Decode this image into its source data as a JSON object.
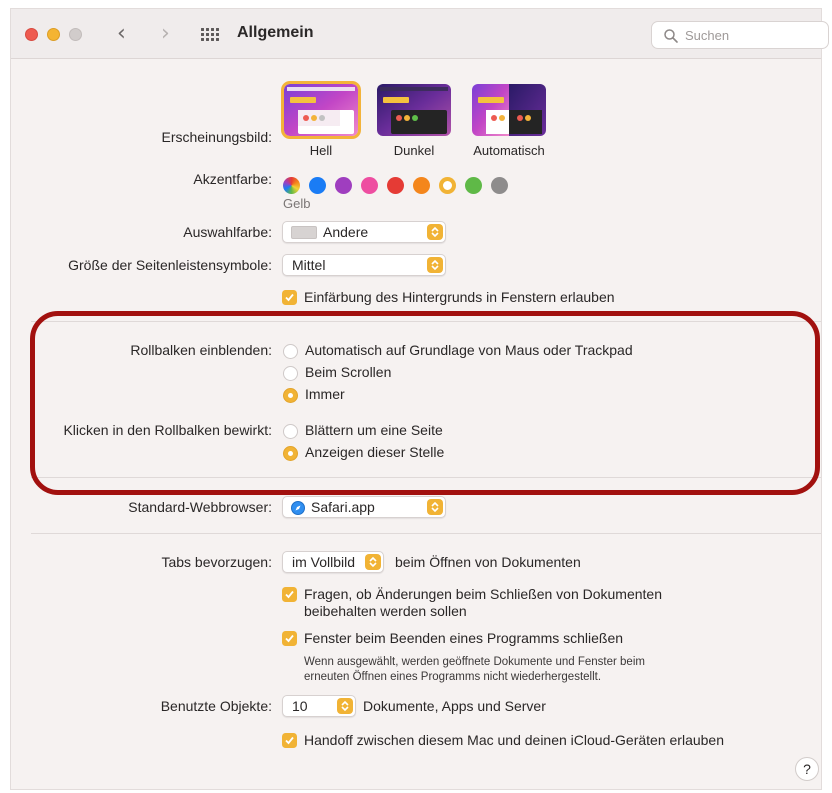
{
  "window": {
    "title": "Allgemein"
  },
  "search": {
    "placeholder": "Suchen"
  },
  "appearance": {
    "label": "Erscheinungsbild:",
    "options": [
      {
        "label": "Hell",
        "selected": true
      },
      {
        "label": "Dunkel",
        "selected": false
      },
      {
        "label": "Automatisch",
        "selected": false
      }
    ]
  },
  "accent": {
    "label": "Akzentfarbe:",
    "selected_name": "Gelb",
    "colors": [
      "multicolor",
      "#1a7cf5",
      "#9f3ebf",
      "#ee4ea1",
      "#e53b35",
      "#f4861c",
      "#f1b335",
      "#5fb947",
      "#8e8c8c"
    ]
  },
  "highlight_color": {
    "label": "Auswahlfarbe:",
    "value": "Andere"
  },
  "sidebar_icon_size": {
    "label": "Größe der Seitenleistensymbole:",
    "value": "Mittel"
  },
  "wallpaper_tinting": {
    "label": "Einfärbung des Hintergrunds in Fenstern erlauben",
    "checked": true
  },
  "show_scroll_bars": {
    "label": "Rollbalken einblenden:",
    "options": [
      {
        "label": "Automatisch auf Grundlage von Maus oder Trackpad",
        "selected": false
      },
      {
        "label": "Beim Scrollen",
        "selected": false
      },
      {
        "label": "Immer",
        "selected": true
      }
    ]
  },
  "click_scroll_bar": {
    "label": "Klicken in den Rollbalken bewirkt:",
    "options": [
      {
        "label": "Blättern um eine Seite",
        "selected": false
      },
      {
        "label": "Anzeigen dieser Stelle",
        "selected": true
      }
    ]
  },
  "default_browser": {
    "label": "Standard-Webbrowser:",
    "value": "Safari.app"
  },
  "prefer_tabs": {
    "label": "Tabs bevorzugen:",
    "value": "im Vollbild",
    "suffix": "beim Öffnen von Dokumenten"
  },
  "ask_keep_changes": {
    "label_line1": "Fragen, ob Änderungen beim Schließen von Dokumenten",
    "label_line2": "beibehalten werden sollen",
    "checked": true
  },
  "close_windows": {
    "label": "Fenster beim Beenden eines Programms schließen",
    "checked": true,
    "note_line1": "Wenn ausgewählt, werden geöffnete Dokumente und Fenster beim",
    "note_line2": "erneuten Öffnen eines Programms nicht wiederhergestellt."
  },
  "recent_items": {
    "label": "Benutzte Objekte:",
    "value": "10",
    "suffix": "Dokumente, Apps und Server"
  },
  "handoff": {
    "label": "Handoff zwischen diesem Mac und deinen iCloud-Geräten erlauben",
    "checked": true
  },
  "help": {
    "label": "?"
  }
}
